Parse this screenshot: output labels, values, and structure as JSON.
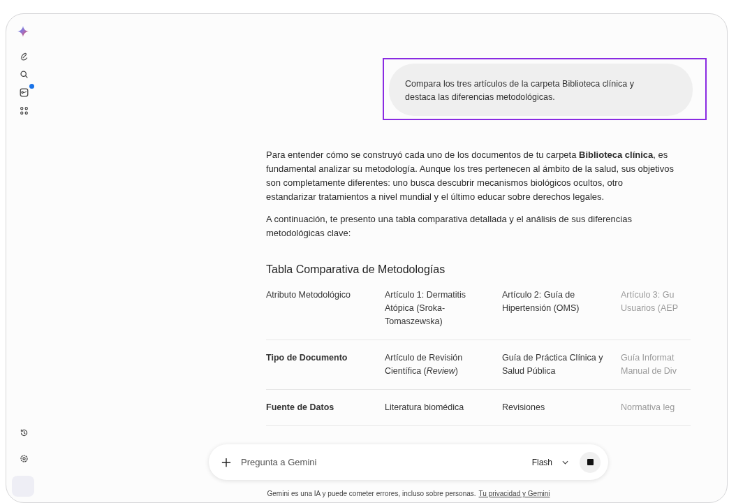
{
  "sidebar": {
    "items": [
      {
        "kind": "pen"
      },
      {
        "kind": "search"
      },
      {
        "kind": "gallery",
        "badge": true
      },
      {
        "kind": "apps"
      }
    ],
    "bottom_items": [
      {
        "kind": "history"
      },
      {
        "kind": "settings"
      }
    ]
  },
  "user_message": {
    "text": "Compara los tres artículos de la carpeta Biblioteca clínica y destaca las diferencias metodológicas.",
    "highlighted": true
  },
  "response": {
    "paragraphs": [
      "Para entender cómo se construyó cada uno de los documentos de tu carpeta **Biblioteca clínica**, es fundamental analizar su metodología. Aunque los tres pertenecen al ámbito de la salud, sus objetivos son completamente diferentes: uno busca descubrir mecanismos biológicos ocultos, otro estandarizar tratamientos a nivel mundial y el último educar sobre derechos legales.",
      "A continuación, te presento una tabla comparativa detallada y el análisis de sus diferencias metodológicas clave:"
    ],
    "table_title": "Tabla Comparativa de Metodologías",
    "table": {
      "columns": [
        "Atributo Metodológico",
        "Artículo 1: Dermatitis Atópica (Sroka-Tomaszewska)",
        "Artículo 2: Guía de Hipertensión (OMS)",
        "Artículo 3: Gu\nUsuarios (AEP"
      ],
      "rows": [
        [
          "Tipo de Documento",
          "Artículo de Revisión Científica (*Review*)",
          "Guía de Práctica Clínica y Salud Pública",
          "Guía Informat\nManual de Div"
        ],
        [
          "Fuente de Datos",
          "Literatura biomédica",
          "Revisiones",
          "Normativa leg"
        ]
      ]
    }
  },
  "input": {
    "placeholder": "Pregunta a Gemini",
    "model": "Flash"
  },
  "footer": {
    "text": "Gemini es una IA y puede cometer errores, incluso sobre personas.",
    "link": "Tu privacidad y Gemini"
  }
}
